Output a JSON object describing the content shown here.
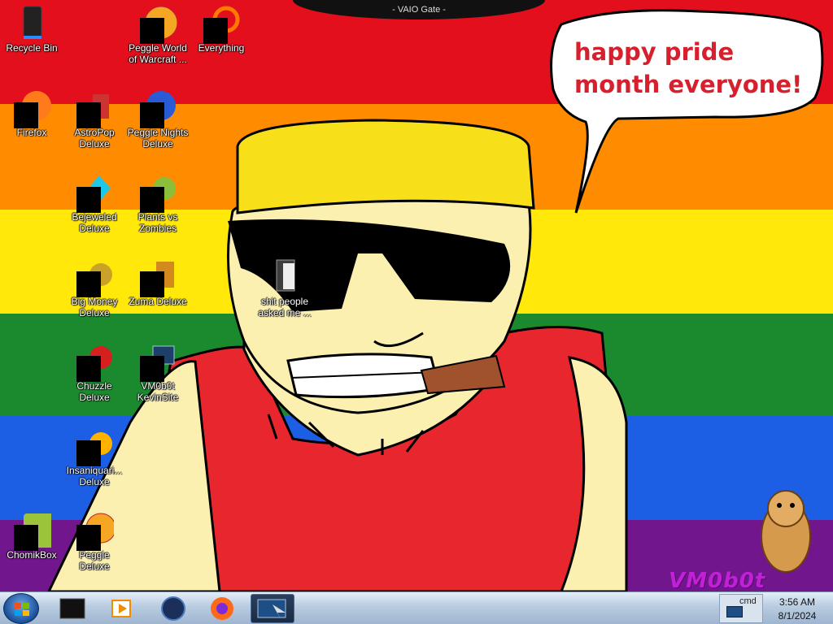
{
  "window": {
    "title": "- VAIO Gate -"
  },
  "wallpaper": {
    "speech_bubble_text": "happy pride month everyone!",
    "watermark": "VM0b0t",
    "stripe_colors": [
      "#e30f1c",
      "#ff8c00",
      "#ffe80a",
      "#1b8a2e",
      "#1c5ee4",
      "#72168e"
    ]
  },
  "desktop_icons": [
    {
      "label": "Recycle Bin",
      "icon": "recycle-bin-icon"
    },
    {
      "label": "Peggle World of Warcraft ...",
      "icon": "peggle-icon"
    },
    {
      "label": "Everything",
      "icon": "everything-search-icon"
    },
    {
      "label": "Firefox",
      "icon": "firefox-icon"
    },
    {
      "label": "AstroPop Deluxe",
      "icon": "astropop-icon"
    },
    {
      "label": "Peggle Nights Deluxe",
      "icon": "peggle-nights-icon"
    },
    {
      "label": "Bejeweled Deluxe",
      "icon": "bejeweled-icon"
    },
    {
      "label": "Plants vs Zombies",
      "icon": "plants-vs-zombies-icon"
    },
    {
      "label": "Big Money Deluxe",
      "icon": "big-money-icon"
    },
    {
      "label": "Zuma Deluxe",
      "icon": "zuma-icon"
    },
    {
      "label": "shit people asked me ...",
      "icon": "folder-icon"
    },
    {
      "label": "Chuzzle Deluxe",
      "icon": "chuzzle-icon"
    },
    {
      "label": "VM0b0t KevinSite",
      "icon": "kevinsite-icon"
    },
    {
      "label": "Insaniquari... Deluxe",
      "icon": "insaniquarium-icon"
    },
    {
      "label": "ChomikBox",
      "icon": "chomikbox-icon"
    },
    {
      "label": "Peggle Deluxe",
      "icon": "peggle-deluxe-icon"
    }
  ],
  "taskbar": {
    "start": "start-orb-icon",
    "pinned": [
      "black-box-icon",
      "media-player-icon",
      "globe-icon",
      "firefox-icon",
      "vaio-gate-window-icon"
    ],
    "tray_cmd_label": "cmd",
    "clock_time": "3:56 AM",
    "clock_date": "8/1/2024"
  }
}
